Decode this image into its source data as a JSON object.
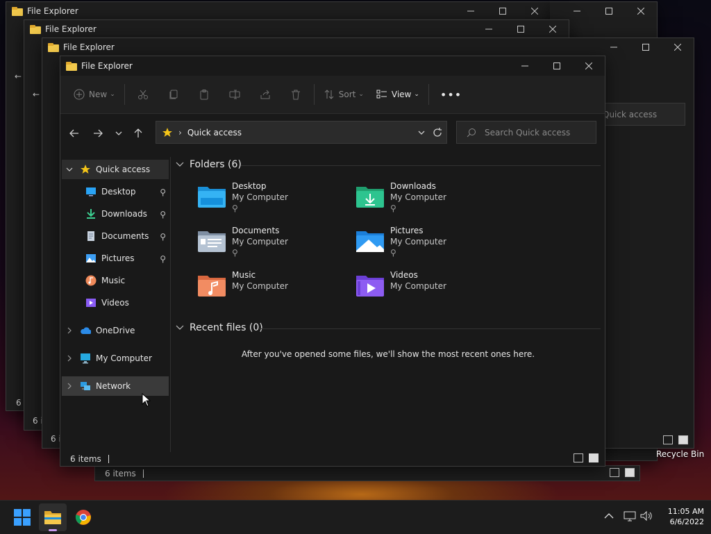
{
  "background_windows": [
    {
      "title": "File Explorer",
      "items": "6 i"
    },
    {
      "title": "File Explorer",
      "items": "6 i"
    },
    {
      "title": "File Explorer",
      "items": "6 i"
    }
  ],
  "back_window_right": {
    "title": "File Explorer",
    "search_placeholder": "Quick access",
    "status": "6 items"
  },
  "main_window": {
    "title": "File Explorer",
    "toolbar": {
      "new_label": "New",
      "sort_label": "Sort",
      "view_label": "View"
    },
    "address": {
      "location": "Quick access"
    },
    "search": {
      "placeholder": "Search Quick access"
    },
    "nav": {
      "quick_access": "Quick access",
      "pinned": [
        "Desktop",
        "Downloads",
        "Documents",
        "Pictures"
      ],
      "unpinned": [
        "Music",
        "Videos"
      ],
      "onedrive": "OneDrive",
      "my_computer": "My Computer",
      "network": "Network"
    },
    "folders_header": "Folders (6)",
    "folders": [
      {
        "name": "Desktop",
        "location": "My Computer",
        "pinned": true,
        "icon": "desktop-folder-icon"
      },
      {
        "name": "Downloads",
        "location": "My Computer",
        "pinned": true,
        "icon": "downloads-folder-icon"
      },
      {
        "name": "Documents",
        "location": "My Computer",
        "pinned": true,
        "icon": "documents-folder-icon"
      },
      {
        "name": "Pictures",
        "location": "My Computer",
        "pinned": true,
        "icon": "pictures-folder-icon"
      },
      {
        "name": "Music",
        "location": "My Computer",
        "pinned": false,
        "icon": "music-folder-icon"
      },
      {
        "name": "Videos",
        "location": "My Computer",
        "pinned": false,
        "icon": "videos-folder-icon"
      }
    ],
    "recent_header": "Recent files (0)",
    "recent_empty": "After you've opened some files, we'll show the most recent ones here.",
    "status": "6 items"
  },
  "desktop": {
    "recycle_bin": "Recycle Bin"
  },
  "taskbar": {
    "time": "11:05 AM",
    "date": "6/6/2022",
    "apps": [
      "start-icon",
      "file-explorer-icon",
      "chrome-icon"
    ]
  },
  "colors": {
    "accent": "#0078d4",
    "folder_yellow": "#f2c94c",
    "window_bg": "#202020"
  }
}
